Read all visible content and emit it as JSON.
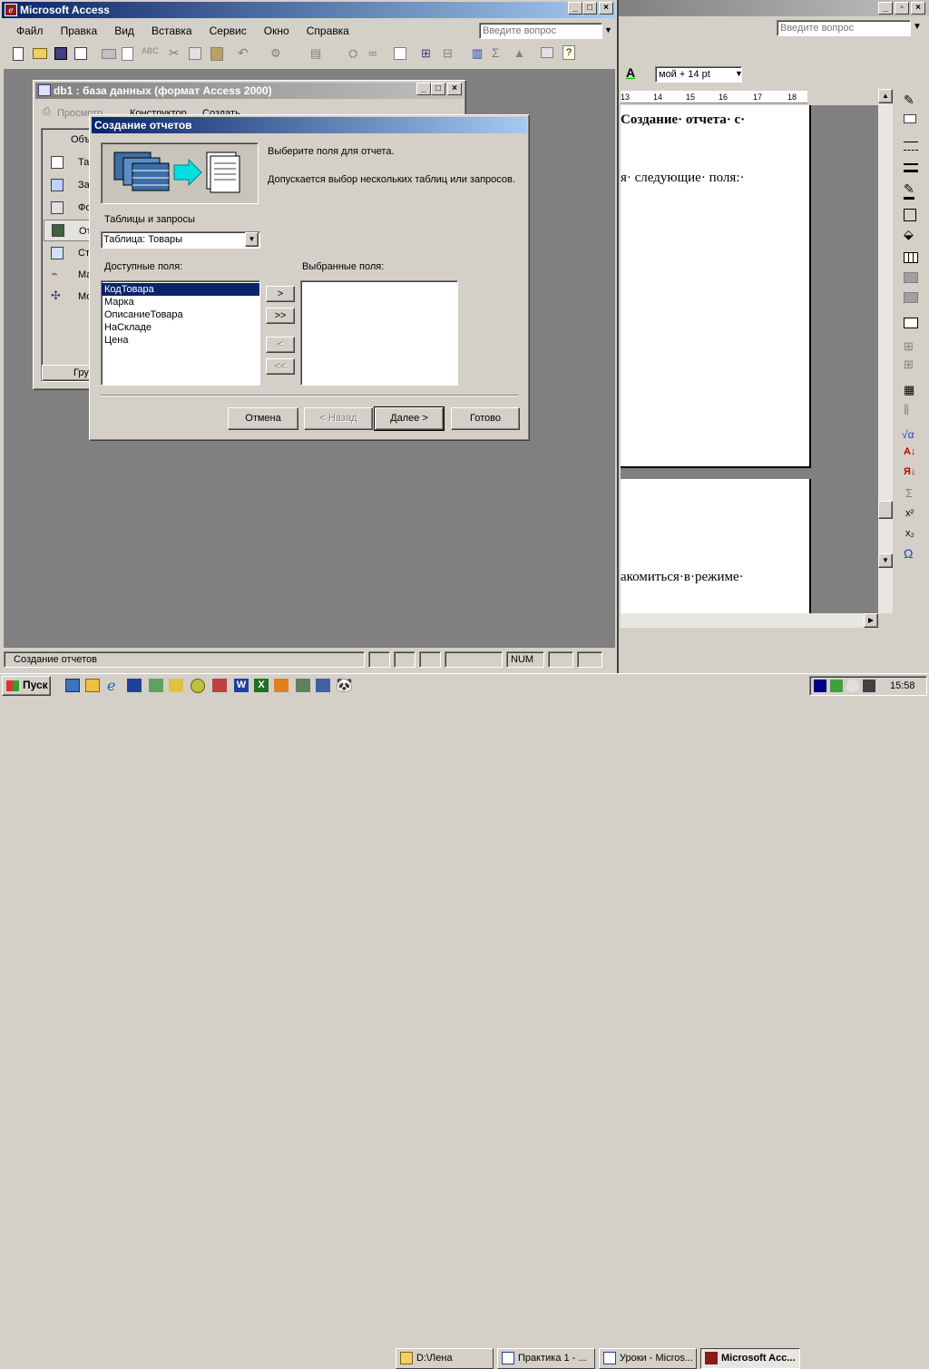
{
  "access": {
    "title": "Microsoft Access",
    "menu": [
      "Файл",
      "Правка",
      "Вид",
      "Вставка",
      "Сервис",
      "Окно",
      "Справка"
    ],
    "help_placeholder": "Введите вопрос",
    "status_text": "Создание отчетов",
    "status_num": "NUM"
  },
  "word": {
    "help_placeholder": "Введите вопрос",
    "style_box": "мой + 14 pt",
    "ruler": [
      "13",
      "14",
      "15",
      "16",
      "17",
      "18"
    ],
    "doc_line1": "Создание· отчета· с·",
    "doc_line2": "я· следующие· поля:·",
    "doc_line3": "акомиться·в·режиме·"
  },
  "db_window": {
    "title": "db1 : база данных (формат Access 2000)",
    "toolbar": [
      "Просмотр",
      "Конструктор",
      "Создать"
    ],
    "objects_header": "Объ",
    "objects": [
      "Та",
      "За",
      "Фо",
      "От",
      "Ст",
      "Ма",
      "Мо"
    ],
    "groups_label": "Гру"
  },
  "wizard": {
    "title": "Создание отчетов",
    "intro1": "Выберите поля для отчета.",
    "intro2": "Допускается выбор нескольких таблиц или запросов.",
    "tables_label": "Таблицы и запросы",
    "table_value": "Таблица: Товары",
    "available_label": "Доступные поля:",
    "selected_label": "Выбранные поля:",
    "available_fields": [
      "КодТовара",
      "Марка",
      "ОписаниеТовара",
      "НаСкладе",
      "Цена"
    ],
    "move_one": ">",
    "move_all": ">>",
    "remove_one": "<",
    "remove_all": "<<",
    "cancel": "Отмена",
    "back": "< Назад",
    "next": "Далее >",
    "finish": "Готово"
  },
  "taskbar": {
    "start": "Пуск",
    "tasks": [
      "D:\\Лена",
      "Практика 1 - ...",
      "Уроки - Micros...",
      "Microsoft Acc..."
    ],
    "clock": "15:58"
  }
}
